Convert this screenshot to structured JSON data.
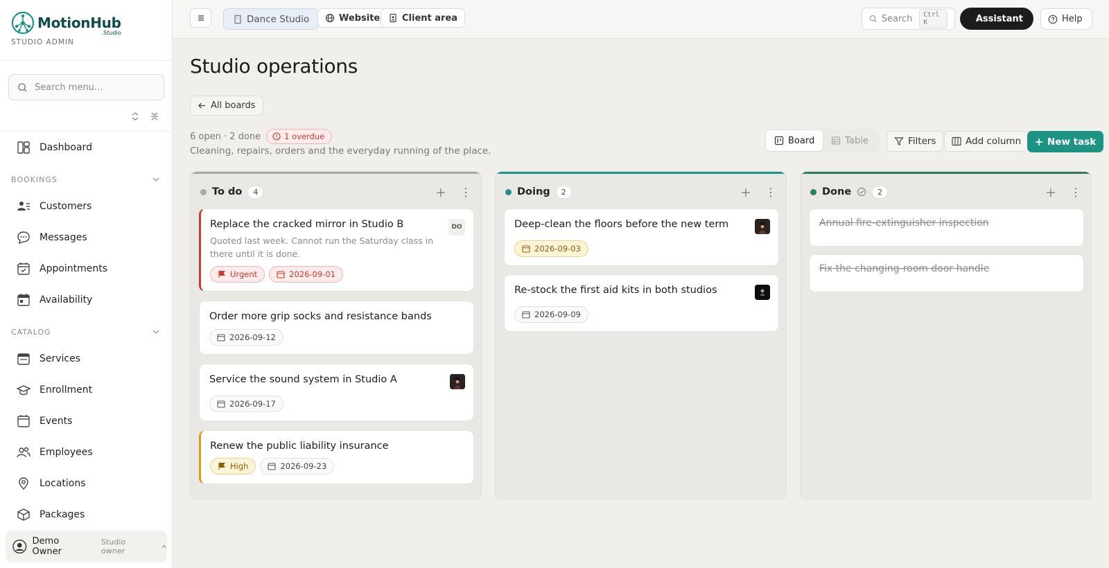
{
  "app": {
    "logo_name": "MotionHub",
    "logo_sub": ".Studio",
    "role_label": "STUDIO ADMIN"
  },
  "sidebar": {
    "search_placeholder": "Search menu...",
    "items": [
      {
        "label": "Dashboard",
        "icon": "dashboard-icon"
      }
    ],
    "sections": [
      {
        "title": "BOOKINGS",
        "items": [
          {
            "label": "Customers",
            "icon": "customers-icon"
          },
          {
            "label": "Messages",
            "icon": "messages-icon"
          },
          {
            "label": "Appointments",
            "icon": "calendar-check-icon"
          },
          {
            "label": "Availability",
            "icon": "calendar-grid-icon"
          }
        ]
      },
      {
        "title": "CATALOG",
        "items": [
          {
            "label": "Services",
            "icon": "services-icon"
          },
          {
            "label": "Enrollment",
            "icon": "graduation-icon"
          },
          {
            "label": "Events",
            "icon": "event-icon"
          },
          {
            "label": "Employees",
            "icon": "employees-icon"
          },
          {
            "label": "Locations",
            "icon": "pin-icon"
          },
          {
            "label": "Packages",
            "icon": "package-icon"
          }
        ]
      }
    ],
    "user": {
      "name": "Demo Owner",
      "role": "Studio owner"
    }
  },
  "topbar": {
    "studio": "Dance Studio",
    "website": "Website",
    "client_area": "Client area",
    "search": "Search",
    "search_kbd": "Ctrl K",
    "assistant": "Assistant",
    "help": "Help"
  },
  "page": {
    "title": "Studio operations",
    "back": "All boards",
    "summary": "6 open · 2 done",
    "overdue": "1 overdue",
    "description": "Cleaning, repairs, orders and the everyday running of the place.",
    "view_board": "Board",
    "view_table": "Table",
    "filters": "Filters",
    "add_column": "Add column",
    "new_task": "New task"
  },
  "columns": [
    {
      "title": "To do",
      "count": "4",
      "color": "#a9a8a3",
      "cards": [
        {
          "title": "Replace the cracked mirror in Studio B",
          "note": "Quoted last week. Cannot run the Saturday class in there until it is done.",
          "priority": "Urgent",
          "date": "2026-09-01",
          "assignee_initials": "DO"
        },
        {
          "title": "Order more grip socks and resistance bands",
          "date": "2026-09-12"
        },
        {
          "title": "Service the sound system in Studio A",
          "date": "2026-09-17"
        },
        {
          "title": "Renew the public liability insurance",
          "priority": "High",
          "date": "2026-09-23"
        }
      ]
    },
    {
      "title": "Doing",
      "count": "2",
      "color": "#1d9384",
      "cards": [
        {
          "title": "Deep-clean the floors before the new term",
          "date": "2026-09-03"
        },
        {
          "title": "Re-stock the first aid kits in both studios",
          "date": "2026-09-09"
        }
      ]
    },
    {
      "title": "Done",
      "count": "2",
      "color": "#2f7d5c",
      "cards": [
        {
          "title": "Annual fire-extinguisher inspection"
        },
        {
          "title": "Fix the changing-room door handle"
        }
      ]
    }
  ],
  "colors": {
    "accent": "#1d9384",
    "urgent": "#c93c2f",
    "high": "#d69e12",
    "dark": "#1c1c1c"
  }
}
